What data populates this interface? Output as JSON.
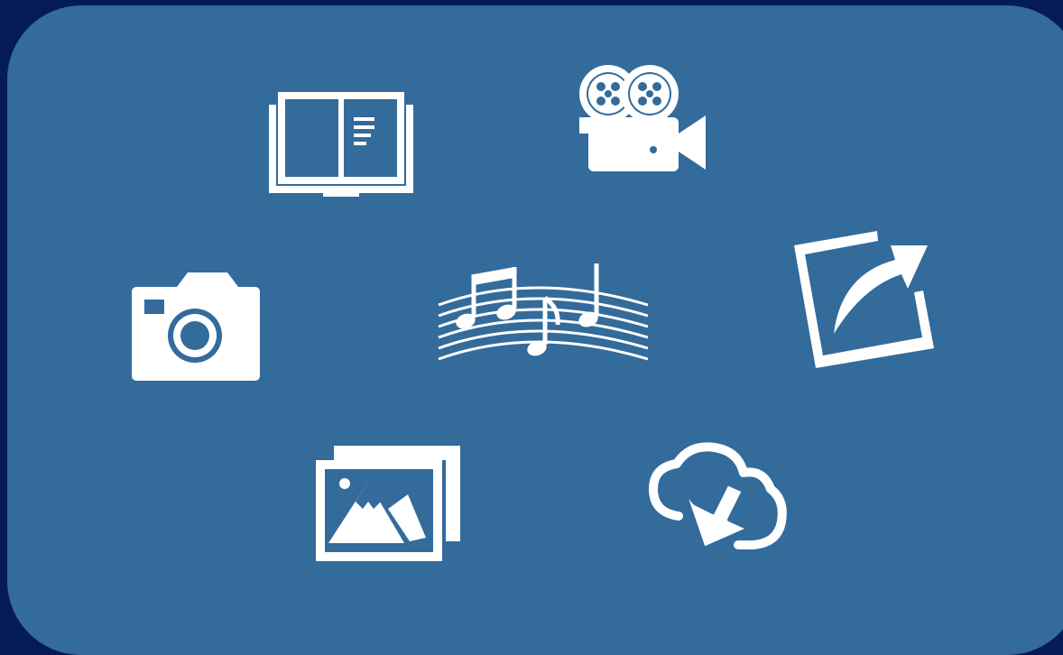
{
  "colors": {
    "background": "#041a59",
    "panel": "#336b9b",
    "icon": "#ffffff"
  },
  "icons": [
    "book-icon",
    "video-camera-icon",
    "camera-icon",
    "music-notes-icon",
    "share-icon",
    "image-gallery-icon",
    "cloud-download-icon"
  ]
}
